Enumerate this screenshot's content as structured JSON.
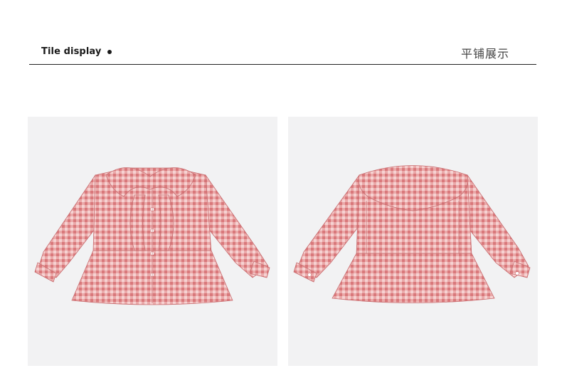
{
  "header": {
    "title_en": "Tile display",
    "title_cn": "平铺展示"
  },
  "images": [
    {
      "name": "blouse-front",
      "description_icon": "gingham-ruffle-blouse-front"
    },
    {
      "name": "blouse-back",
      "description_icon": "gingham-ruffle-blouse-back"
    }
  ],
  "colors": {
    "fabric": "#e08c8e",
    "fabric_light": "#f6d2d2",
    "line": "#ffffff",
    "panel_bg": "#f2f2f3"
  }
}
